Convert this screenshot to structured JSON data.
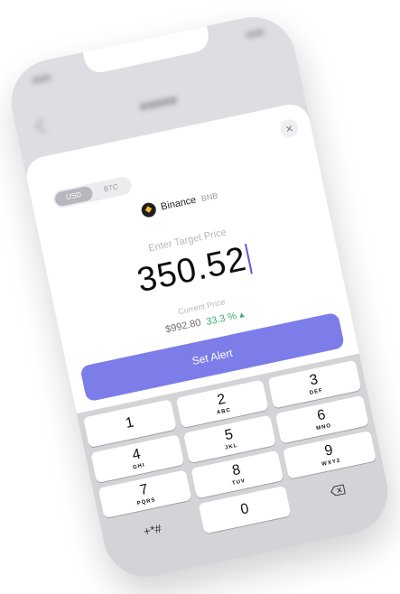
{
  "currency_toggle": {
    "options": [
      "USD",
      "BTC"
    ],
    "selected": "USD"
  },
  "asset": {
    "name": "Binance",
    "ticker": "BNB",
    "icon": "bnb-coin-icon"
  },
  "target": {
    "label": "Enter Target Price",
    "value": "350.52"
  },
  "current": {
    "label": "Current Price",
    "price": "$992.80",
    "change": "33.3 % ▴"
  },
  "actions": {
    "set_alert": "Set Alert",
    "close": "×"
  },
  "keypad": {
    "keys": [
      {
        "digit": "1",
        "letters": ""
      },
      {
        "digit": "2",
        "letters": "ABC"
      },
      {
        "digit": "3",
        "letters": "DEF"
      },
      {
        "digit": "4",
        "letters": "GHI"
      },
      {
        "digit": "5",
        "letters": "JKL"
      },
      {
        "digit": "6",
        "letters": "MNO"
      },
      {
        "digit": "7",
        "letters": "PQRS"
      },
      {
        "digit": "8",
        "letters": "TUV"
      },
      {
        "digit": "9",
        "letters": "WXYZ"
      }
    ],
    "symbols": "+*#",
    "zero": "0"
  },
  "colors": {
    "accent": "#7c7de8",
    "positive": "#3cb371",
    "caret": "#5b5bd6"
  }
}
